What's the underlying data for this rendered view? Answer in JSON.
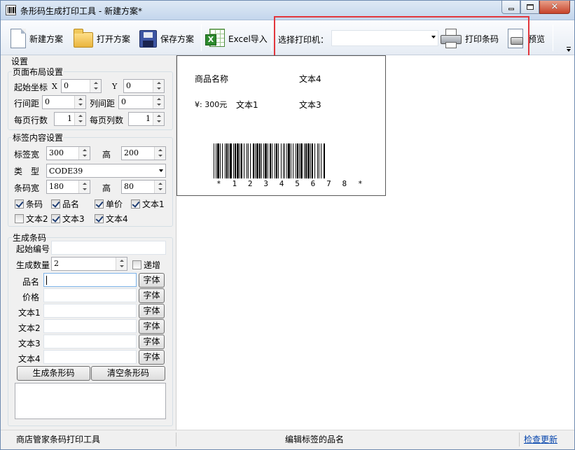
{
  "window": {
    "title": "条形码生成打印工具 - 新建方案*"
  },
  "toolbar": {
    "new_label": "新建方案",
    "open_label": "打开方案",
    "save_label": "保存方案",
    "excel_label": "Excel导入",
    "printer_label": "选择打印机：",
    "printer_value": "",
    "print_label": "打印条码",
    "preview_label": "预览"
  },
  "settings": {
    "title": "设置",
    "layout": {
      "title": "页面布局设置",
      "start_label": "起始坐标",
      "x_label": "X",
      "x_value": "0",
      "y_label": "Y",
      "y_value": "0",
      "row_gap_label": "行间距",
      "row_gap_value": "0",
      "col_gap_label": "列间距",
      "col_gap_value": "0",
      "rows_label": "每页行数",
      "rows_value": "1",
      "cols_label": "每页列数",
      "cols_value": "1"
    },
    "content": {
      "title": "标签内容设置",
      "width_label": "标签宽",
      "width_value": "300",
      "height_label": "高",
      "height_value": "200",
      "type_label": "类　型",
      "type_value": "CODE39",
      "bc_width_label": "条码宽",
      "bc_width_value": "180",
      "bc_height_label": "高",
      "bc_height_value": "80",
      "checks": [
        {
          "label": "条码",
          "checked": true
        },
        {
          "label": "品名",
          "checked": true
        },
        {
          "label": "单价",
          "checked": true
        },
        {
          "label": "文本1",
          "checked": true
        },
        {
          "label": "文本2",
          "checked": false
        },
        {
          "label": "文本3",
          "checked": true
        },
        {
          "label": "文本4",
          "checked": true
        }
      ]
    },
    "generate": {
      "title": "生成条码",
      "start_no_label": "起始编号",
      "start_no_value": "",
      "count_label": "生成数量",
      "count_value": "2",
      "increment_label": "递增",
      "fields": [
        {
          "label": "品名",
          "value": "",
          "font_btn": "字体"
        },
        {
          "label": "价格",
          "value": "",
          "font_btn": "字体"
        },
        {
          "label": "文本1",
          "value": "",
          "font_btn": "字体"
        },
        {
          "label": "文本2",
          "value": "",
          "font_btn": "字体"
        },
        {
          "label": "文本3",
          "value": "",
          "font_btn": "字体"
        },
        {
          "label": "文本4",
          "value": "",
          "font_btn": "字体"
        }
      ],
      "generate_btn": "生成条形码",
      "clear_btn": "清空条形码"
    }
  },
  "preview": {
    "product_name": "商品名称",
    "text4": "文本4",
    "price": "¥: 300元",
    "text1": "文本1",
    "text3": "文本3",
    "barcode_text": "* 1 2 3 4 5 6 7 8 *"
  },
  "status": {
    "left": "商店管家条码打印工具",
    "middle": "编辑标签的品名",
    "link": "检查更新"
  },
  "colors": {
    "highlight": "#e2373d",
    "link": "#0645ad"
  }
}
